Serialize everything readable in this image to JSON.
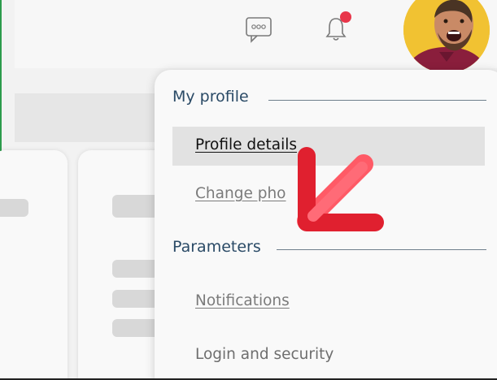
{
  "header": {
    "chat_icon": "chat-bubble-icon",
    "bell_icon": "bell-icon",
    "notification_dot_color": "#e8364a",
    "avatar": "user-avatar"
  },
  "menu": {
    "profile_section_title": "My profile",
    "profile_items": [
      {
        "label": "Profile details",
        "state": "active"
      },
      {
        "label": "Change pho"
      }
    ],
    "parameters_section_title": "Parameters",
    "parameters_items": [
      {
        "label": "Notifications"
      },
      {
        "label": "Login and security"
      }
    ]
  },
  "overlay": {
    "pointer_arrow_color": "#e0202f"
  }
}
